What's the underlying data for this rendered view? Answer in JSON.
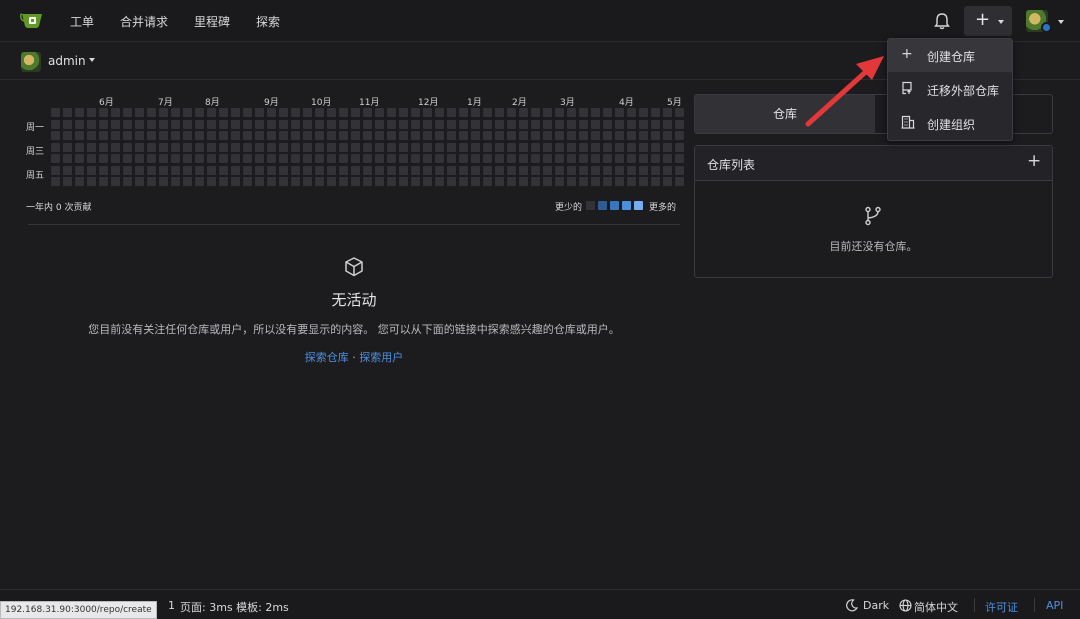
{
  "nav": {
    "logo": "gitea-logo-icon",
    "items": [
      "工单",
      "合并请求",
      "里程碑",
      "探索"
    ]
  },
  "context": {
    "user": "admin"
  },
  "heatmap": {
    "months": [
      "6月",
      "7月",
      "8月",
      "9月",
      "10月",
      "11月",
      "12月",
      "1月",
      "2月",
      "3月",
      "4月",
      "5月"
    ],
    "weekdays": [
      "周一",
      "周三",
      "周五"
    ],
    "total_label": "一年内 0 次贡献",
    "less_label": "更少的",
    "more_label": "更多的",
    "contributions": 0,
    "colors": {
      "empty": "#333337",
      "levels": [
        "#333337",
        "#2d5d92",
        "#3a76bd",
        "#4c8fdc",
        "#77adf0"
      ]
    }
  },
  "feed": {
    "title": "无活动",
    "description": "您目前没有关注任何仓库或用户，所以没有要显示的内容。 您可以从下面的链接中探索感兴趣的仓库或用户。",
    "link_repos": "探索仓库",
    "link_sep": " · ",
    "link_users": "探索用户"
  },
  "sidebar": {
    "tab_repos": "仓库",
    "repo_list_title": "仓库列表",
    "repo_add": "+",
    "repo_empty": "目前还没有仓库。"
  },
  "dropdown": {
    "items": [
      {
        "label": "创建仓库",
        "icon": "plus-icon"
      },
      {
        "label": "迁移外部仓库",
        "icon": "repo-push-icon"
      },
      {
        "label": "创建组织",
        "icon": "organization-icon"
      }
    ]
  },
  "footer": {
    "page_time": "页面: 3ms 模板: 2ms",
    "version_frag": "1",
    "theme": "Dark",
    "language": "简体中文",
    "license": "许可证",
    "api": "API",
    "status_url": "192.168.31.90:3000/repo/create"
  },
  "colors": {
    "accent": "#4f8fe0",
    "arrow": "#e2383a"
  }
}
